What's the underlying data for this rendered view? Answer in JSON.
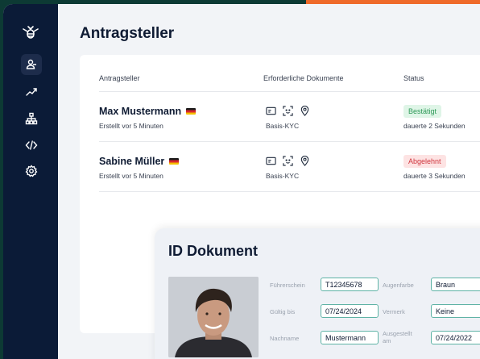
{
  "page": {
    "title": "Antragsteller"
  },
  "colors": {
    "accent": "#ef6a2a",
    "sidebar": "#0b1b37",
    "approved": "#2f9a59",
    "rejected": "#d0363e"
  },
  "sidebar": {
    "logo": "bee-logo-icon",
    "items": [
      {
        "name": "users-icon",
        "active": true
      },
      {
        "name": "trend-chart-icon"
      },
      {
        "name": "org-hierarchy-icon"
      },
      {
        "name": "code-icon"
      },
      {
        "name": "gear-icon"
      }
    ]
  },
  "table": {
    "headers": [
      "Antragsteller",
      "Erforderliche Dokumente",
      "Status"
    ],
    "rows": [
      {
        "name": "Max Mustermann",
        "flag": "de-flag-icon",
        "created": "Erstellt vor 5 Minuten",
        "docs": "Basis-KYC",
        "status": "Bestätigt",
        "duration": "dauerte 2 Sekunden"
      },
      {
        "name": "Sabine Müller",
        "flag": "de-flag-icon",
        "created": "Erstellt vor 5 Minuten",
        "docs": "Basis-KYC",
        "status": "Abgelehnt",
        "duration": "dauerte 3 Sekunden"
      }
    ]
  },
  "id_panel": {
    "title": "ID Dokument",
    "fields": {
      "license_label": "Führerschein",
      "license_value": "T12345678",
      "valid_label": "Gültig bis",
      "valid_value": "07/24/2024",
      "lastname_label": "Nachname",
      "lastname_value": "Mustermann",
      "eye_label": "Augenfarbe",
      "eye_value": "Braun",
      "note_label": "Vermerk",
      "note_value": "Keine",
      "issued_label": "Ausgestellt am",
      "issued_value": "07/24/2022"
    }
  }
}
